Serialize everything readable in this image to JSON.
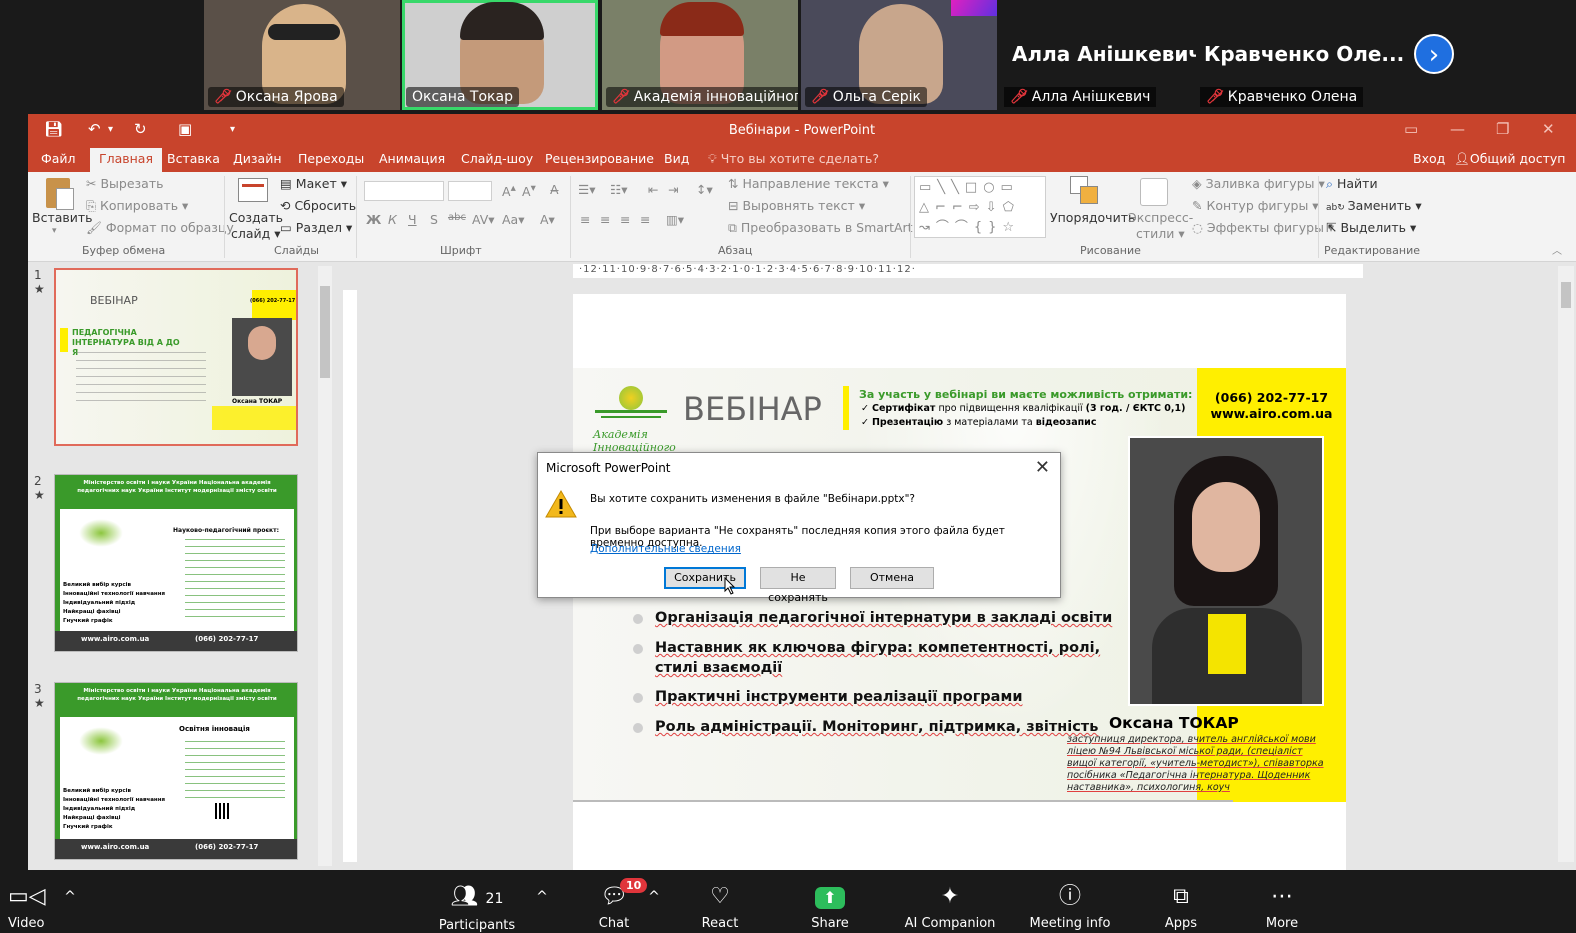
{
  "zoom": {
    "participants_video": [
      {
        "name": "Оксана Ярова",
        "muted": true
      },
      {
        "name": "Оксана Токар",
        "muted": false,
        "active_speaker": true
      },
      {
        "name": "Академія інноваційного ...",
        "muted": true
      },
      {
        "name": "Ольга Серік",
        "muted": true
      }
    ],
    "participants_name_only": [
      {
        "display": "Алла Анішкевич",
        "name": "Алла Анішкевич",
        "muted": true
      },
      {
        "display": "Кравченко Оле...",
        "name": "Кравченко Олена",
        "muted": true
      }
    ],
    "next_icon": "chevron-right-icon",
    "toolbar": {
      "video": "Video",
      "participants": "Participants",
      "participants_count": "21",
      "chat": "Chat",
      "chat_badge": "10",
      "react": "React",
      "share": "Share",
      "ai": "AI Companion",
      "meeting_info": "Meeting info",
      "apps": "Apps",
      "more": "More"
    }
  },
  "powerpoint": {
    "window_title": "Вебінари - PowerPoint",
    "menu": {
      "file": "Файл",
      "home": "Главная",
      "insert": "Вставка",
      "design": "Дизайн",
      "transitions": "Переходы",
      "animation": "Анимация",
      "slideshow": "Слайд-шоу",
      "review": "Рецензирование",
      "view": "Вид",
      "tell_me": "Что вы хотите сделать?",
      "signin": "Вход",
      "share": "Общий доступ"
    },
    "ribbon": {
      "paste": "Вставить",
      "cut": "Вырезать",
      "copy": "Копировать",
      "format_painter": "Формат по образцу",
      "clipboard_group": "Буфер обмена",
      "new_slide_1": "Создать",
      "new_slide_2": "слайд",
      "layout": "Макет",
      "reset": "Сбросить",
      "section": "Раздел",
      "slides_group": "Слайды",
      "font_group": "Шрифт",
      "text_direction": "Направление текста",
      "align_text": "Выровнять текст",
      "smartart": "Преобразовать в SmartArt",
      "paragraph_group": "Абзац",
      "arrange": "Упорядочить",
      "quick_styles_1": "Экспресс-",
      "quick_styles_2": "стили",
      "shape_fill": "Заливка фигуры",
      "shape_outline": "Контур фигуры",
      "shape_effects": "Эффекты фигуры",
      "drawing_group": "Рисование",
      "find": "Найти",
      "replace": "Заменить",
      "select": "Выделить",
      "editing_group": "Редактирование"
    },
    "slide_numbers": [
      "1",
      "2",
      "3"
    ],
    "ruler_text": "·12·11·10·9·8·7·6·5·4·3·2·1·0·1·2·3·4·5·6·7·8·9·10·11·12·",
    "slide": {
      "webinar": "ВЕБІНАР",
      "logo_text": "Академія Інноваційного",
      "offer_title": "За участь у вебінарі ви маєте можливість отримати:",
      "offer_1_bold": "Сертифікат",
      "offer_1_rest": "про підвищення кваліфікації",
      "offer_1_hours": "(3 год. / ЄКТС 0,1)",
      "offer_2_bold": "Презентацію",
      "offer_2_rest": "з матеріалами та",
      "offer_2_video": "відеозапис",
      "phone": "(066) 202-77-17",
      "site": "www.airo.com.ua",
      "bullets": [
        "Організація педагогічної інтернатури в закладі освіти",
        "Наставник як ключова фігура: компетентності, ролі,",
        "стилі взаємодії",
        "Практичні інструменти реалізації програми",
        "Роль адміністрації. Моніторинг, підтримка, звітність"
      ],
      "speaker_name": "Оксана ТОКАР",
      "speaker_bio": "заступниця директора, вчитель англійської мови ліцею №94 Львівської міської ради, (спеціаліст вищої категорії, «учитель-методист»), співавторка посібника «Педагогічна інтернатура. Щоденник наставника», психологиня, коуч"
    },
    "thumb1": {
      "webinar": "ВЕБІНАР",
      "title": "ПЕДАГОГІЧНА ІНТЕРНАТУРА ВІД А ДО Я",
      "name": "Оксана ТОКАР",
      "phone": "(066) 202-77-17"
    },
    "thumb2": {
      "header": "Міністерство освіти і науки України Національна академія педагогічних наук України Інститут модернізації змісту освіти",
      "project": "Науково-педагогічний проєкт:",
      "list": [
        "Великий вибір курсів",
        "Інноваційні технології навчання",
        "Індивідуальний підхід",
        "Найкращі фахівці",
        "Гнучкий графік"
      ],
      "site": "www.airo.com.ua",
      "phone": "(066) 202-77-17"
    },
    "thumb3": {
      "header": "Міністерство освіти і науки України Національна академія педагогічних наук України Інститут модернізації змісту освіти",
      "project": "Освітня інновація",
      "list": [
        "Великий вибір курсів",
        "Інноваційні технології навчання",
        "Індивідуальний підхід",
        "Найкращі фахівці",
        "Гнучкий графік"
      ],
      "site": "www.airo.com.ua",
      "phone": "(066) 202-77-17"
    }
  },
  "dialog": {
    "title": "Microsoft PowerPoint",
    "message": "Вы хотите сохранить изменения в файле \"Вебінари.pptx\"?",
    "detail": "При выборе варианта \"Не сохранять\" последняя копия этого файла будет временно доступна.",
    "link": "Дополнительные сведения",
    "save": "Сохранить",
    "dont_save": "Не сохранять",
    "cancel": "Отмена"
  },
  "colors": {
    "ppt_accent": "#c8442c",
    "zoom_bg": "#1a1a1a",
    "active_speaker": "#38d86a",
    "brand_yellow": "#ffef00",
    "brand_green": "#3a9a2a"
  }
}
